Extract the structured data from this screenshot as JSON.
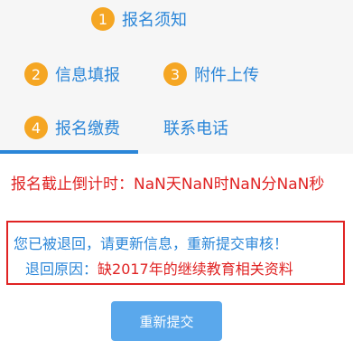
{
  "tabs": [
    {
      "number": "1",
      "label": "报名须知"
    },
    {
      "number": "2",
      "label": "信息填报"
    },
    {
      "number": "3",
      "label": "附件上传"
    },
    {
      "number": "4",
      "label": "报名缴费"
    },
    {
      "label": "联系电话"
    }
  ],
  "active_tab_index": 3,
  "countdown": {
    "text": "报名截止倒计时：NaN天NaN时NaN分NaN秒"
  },
  "notice": {
    "message": "您已被退回，请更新信息，重新提交审核！",
    "reason_label": "退回原因：",
    "reason_value": "缺2017年的继续教育相关资料"
  },
  "resubmit_button": {
    "label": "重新提交"
  },
  "colors": {
    "primary": "#2b86d8",
    "badge": "#f5a623",
    "alert": "#e02323",
    "button": "#5aa8ec"
  }
}
